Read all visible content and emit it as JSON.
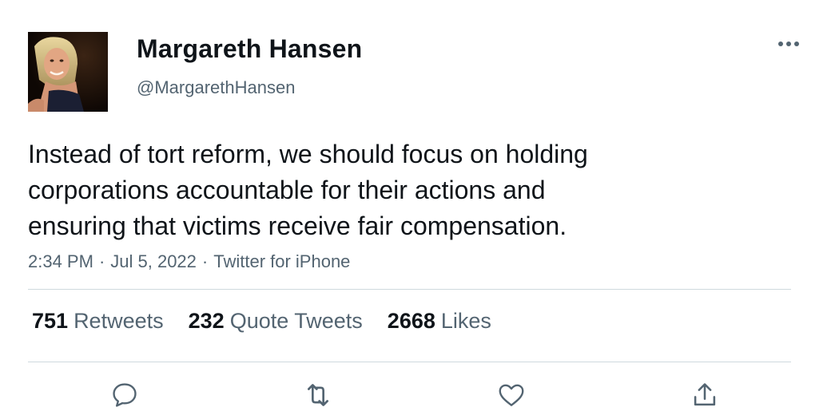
{
  "tweet": {
    "author": {
      "display_name": "Margareth Hansen",
      "handle": "@MargarethHansen",
      "avatar_alt": "profile-photo"
    },
    "text": "Instead of tort reform, we should focus on holding\ncorporations accountable for their actions and\nensuring that victims receive fair compensation.",
    "time": "2:34 PM",
    "date": "Jul 5, 2022",
    "source": "Twitter for iPhone",
    "separator": "·",
    "stats": {
      "retweets": {
        "count": "751",
        "label": "Retweets"
      },
      "quotes": {
        "count": "232",
        "label": "Quote Tweets"
      },
      "likes": {
        "count": "2668",
        "label": "Likes"
      }
    }
  },
  "icons": {
    "more": "more-dots-icon",
    "reply": "reply-bubble-icon",
    "retweet": "retweet-arrows-icon",
    "like": "heart-icon",
    "share": "share-upload-icon"
  },
  "colors": {
    "primary_text": "#0f1419",
    "secondary_text": "#536471",
    "divider": "#cfd9de",
    "icon": "#536471"
  }
}
